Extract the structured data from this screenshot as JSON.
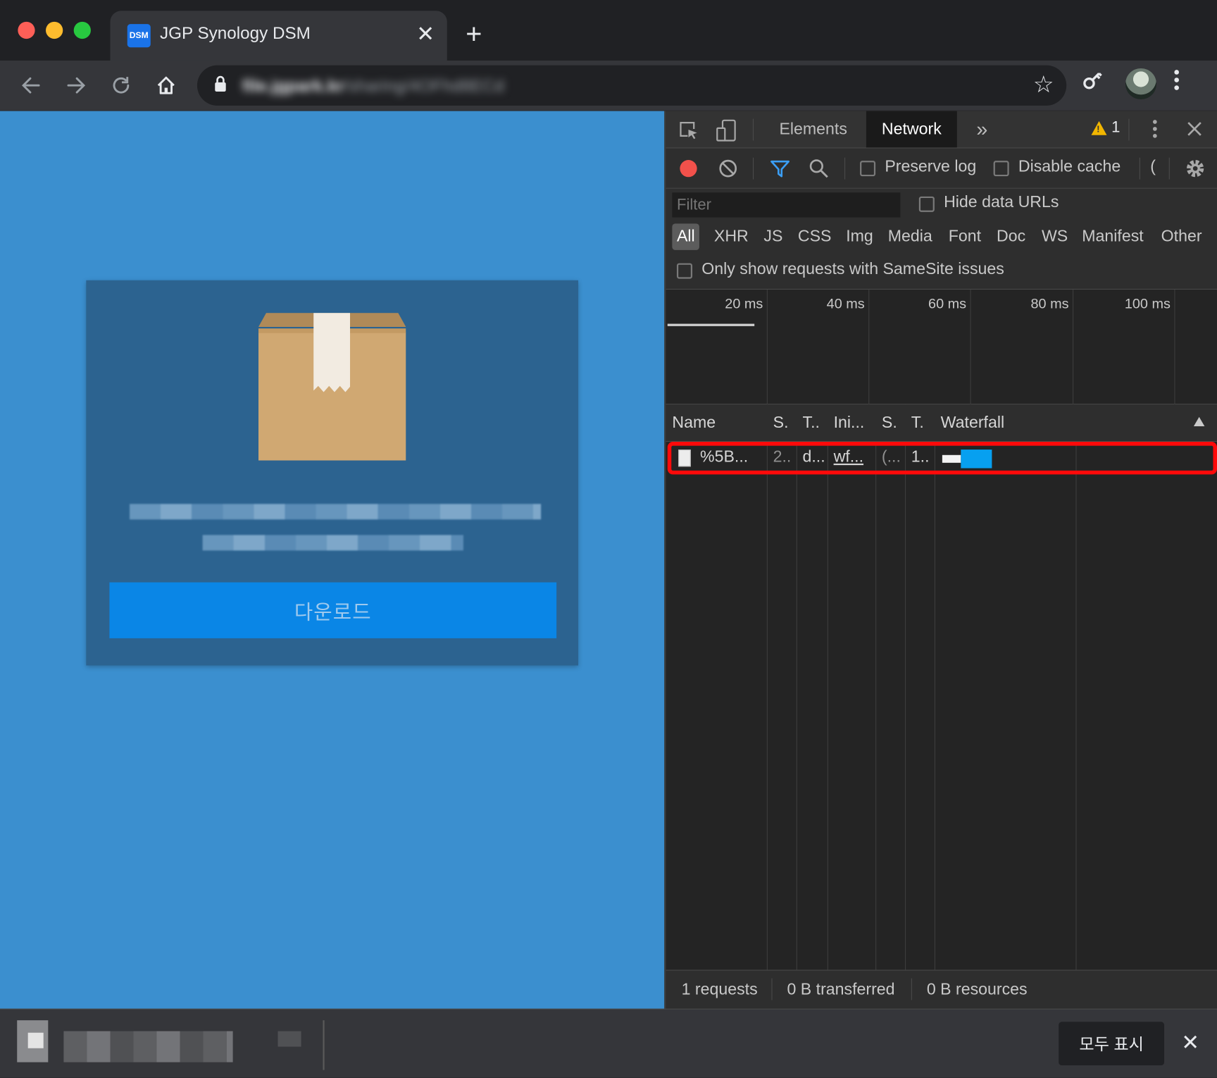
{
  "browser": {
    "tab": {
      "favicon_text": "DSM",
      "title": "JGP Synology DSM",
      "close": "✕"
    },
    "new_tab": "+",
    "omnibox": {
      "host": "file.jgpark.kr",
      "path": "/sharing/4OFhd8ECd"
    }
  },
  "page": {
    "download_button": "다운로드"
  },
  "devtools": {
    "tabs": [
      "Elements",
      "Network"
    ],
    "more_tabs": "»",
    "warning_count": "1",
    "toolbar": {
      "preserve_log": "Preserve log",
      "disable_cache": "Disable cache",
      "truncated": "("
    },
    "filter": {
      "placeholder": "Filter",
      "hide_data_urls": "Hide data URLs"
    },
    "types": [
      "All",
      "XHR",
      "JS",
      "CSS",
      "Img",
      "Media",
      "Font",
      "Doc",
      "WS",
      "Manifest",
      "Other"
    ],
    "samesite": "Only show requests with SameSite issues",
    "overview_ticks": [
      "20 ms",
      "40 ms",
      "60 ms",
      "80 ms",
      "100 ms"
    ],
    "columns": [
      "Name",
      "S.",
      "T..",
      "Ini...",
      "S.",
      "T.",
      "Waterfall"
    ],
    "request": {
      "name": "%5B...",
      "status": "2..",
      "type": "d...",
      "initiator": "wf...",
      "size": "(...",
      "time": "1.."
    },
    "status": {
      "requests": "1 requests",
      "transferred": "0 B transferred",
      "resources": "0 B resources"
    }
  },
  "shelf": {
    "show_all": "모두 표시",
    "close": "✕"
  },
  "colors": {
    "page_bg": "#3b8fcf",
    "card_bg": "#2c6390",
    "button_bg": "#0a86e6",
    "record": "#f2514b",
    "highlight": "#ff0a0a",
    "waterfall_bar": "#07a0f0"
  }
}
